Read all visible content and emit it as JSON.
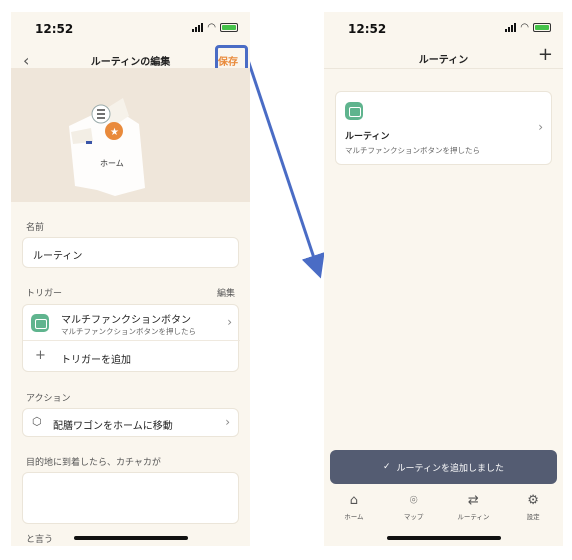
{
  "status": {
    "time": "12:52"
  },
  "left": {
    "nav": {
      "title": "ルーティンの編集",
      "save": "保存"
    },
    "hero": {
      "tag": "ホーム"
    },
    "name": {
      "label": "名前",
      "value": "ルーティン"
    },
    "trigger": {
      "label": "トリガー",
      "edit": "編集",
      "item_title": "マルチファンクションボタン",
      "item_sub": "マルチファンクションボタンを押したら",
      "add": "トリガーを追加"
    },
    "action": {
      "label": "アクション",
      "item": "配膳ワゴンをホームに移動"
    },
    "arrival": {
      "label": "目的地に到着したら、カチャカが"
    },
    "say": {
      "label": "と言う"
    }
  },
  "right": {
    "nav": {
      "title": "ルーティン"
    },
    "routine": {
      "title": "ルーティン",
      "sub": "マルチファンクションボタンを押したら"
    },
    "toast": "ルーティンを追加しました",
    "tabs": [
      {
        "label": "ホーム",
        "icon": "home-icon"
      },
      {
        "label": "マップ",
        "icon": "map-pin-icon"
      },
      {
        "label": "ルーティン",
        "icon": "routine-icon"
      },
      {
        "label": "設定",
        "icon": "gear-icon"
      }
    ]
  },
  "colors": {
    "accent": "#e98a3b",
    "annotation": "#4a6cc5",
    "app_green": "#5fb48e",
    "toast_bg": "#545c72"
  }
}
